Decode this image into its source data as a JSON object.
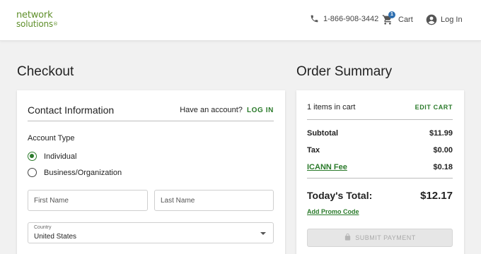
{
  "header": {
    "logo_line1": "network",
    "logo_line2": "solutions",
    "logo_reg": "®",
    "phone": "1-866-908-3442",
    "cart_label": "Cart",
    "cart_count": "1",
    "login_label": "Log In",
    "icons": {
      "phone": "phone-icon",
      "cart": "cart-icon",
      "account": "account-icon"
    },
    "brand_color": "#5f8f2a"
  },
  "checkout": {
    "title": "Checkout",
    "contact_title": "Contact Information",
    "have_account": "Have an account?",
    "login_link": "LOG IN",
    "account_type_label": "Account Type",
    "account_types": [
      {
        "label": "Individual",
        "selected": true
      },
      {
        "label": "Business/Organization",
        "selected": false
      }
    ],
    "first_name": {
      "placeholder": "First Name",
      "value": ""
    },
    "last_name": {
      "placeholder": "Last Name",
      "value": ""
    },
    "country": {
      "label": "Country",
      "value": "United States"
    }
  },
  "summary": {
    "title": "Order Summary",
    "cart_count": "1 items in cart",
    "edit_cart": "EDIT CART",
    "lines": [
      {
        "name": "Subtotal",
        "amount": "$11.99"
      },
      {
        "name": "Tax",
        "amount": "$0.00"
      },
      {
        "name": "ICANN Fee",
        "amount": "$0.18"
      }
    ],
    "total_label": "Today's Total:",
    "total_amount": "$12.17",
    "promo_link": "Add Promo Code",
    "submit_label": "SUBMIT PAYMENT",
    "accent_color": "#2a7a2a"
  }
}
